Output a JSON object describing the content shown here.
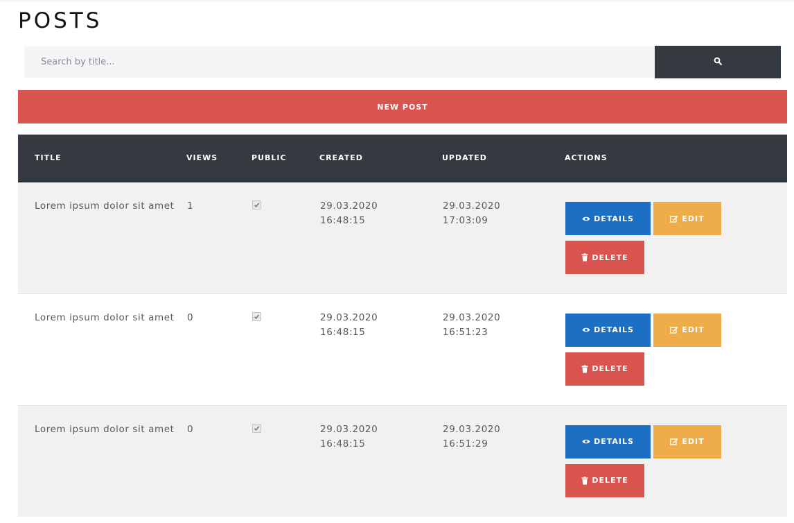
{
  "page": {
    "title": "POSTS"
  },
  "search": {
    "placeholder": "Search by title...",
    "button_icon": "search-icon"
  },
  "new_post": {
    "label": "NEW POST"
  },
  "colors": {
    "dark": "#353940",
    "danger": "#d9534f",
    "primary": "#1d6fc3",
    "warning": "#efac4b",
    "row_shade": "#f1f1f1"
  },
  "table": {
    "headers": {
      "title": "TITLE",
      "views": "VIEWS",
      "public": "PUBLIC",
      "created": "CREATED",
      "updated": "UPDATED",
      "actions": "ACTIONS"
    },
    "rows": [
      {
        "title": "Lorem ipsum dolor sit amet",
        "views": "1",
        "public": true,
        "created_date": "29.03.2020",
        "created_time": "16:48:15",
        "updated_date": "29.03.2020",
        "updated_time": "17:03:09"
      },
      {
        "title": "Lorem ipsum dolor sit amet",
        "views": "0",
        "public": true,
        "created_date": "29.03.2020",
        "created_time": "16:48:15",
        "updated_date": "29.03.2020",
        "updated_time": "16:51:23"
      },
      {
        "title": "Lorem ipsum dolor sit amet",
        "views": "0",
        "public": true,
        "created_date": "29.03.2020",
        "created_time": "16:48:15",
        "updated_date": "29.03.2020",
        "updated_time": "16:51:29"
      }
    ],
    "actions": {
      "details": "DETAILS",
      "edit": "EDIT",
      "delete": "DELETE"
    }
  }
}
